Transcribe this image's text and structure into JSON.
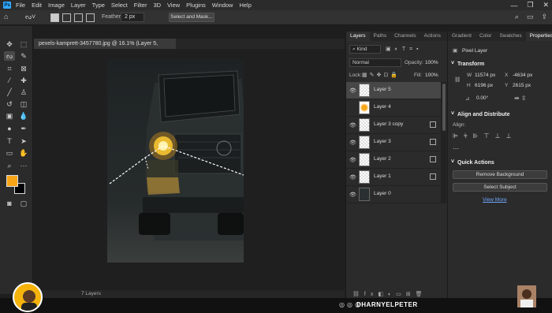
{
  "menu": {
    "items": [
      "File",
      "Edit",
      "Image",
      "Layer",
      "Type",
      "Select",
      "Filter",
      "3D",
      "View",
      "Plugins",
      "Window",
      "Help"
    ]
  },
  "options": {
    "feather_label": "Feather:",
    "feather_value": "2 px",
    "select_mask": "Select and Mask..."
  },
  "document": {
    "tab_title": "pexels-kamprett-3457780.jpg @ 16.1% (Layer 5, RGB/8) *",
    "status": "7 Layers"
  },
  "layers_panel": {
    "tabs": [
      "Layers",
      "Paths",
      "Channels",
      "Actions"
    ],
    "kind": "Kind",
    "blend_mode": "Normal",
    "opacity_label": "Opacity:",
    "opacity_value": "100%",
    "lock_label": "Lock:",
    "fill_label": "Fill:",
    "fill_value": "100%",
    "layers": [
      {
        "name": "Layer 5",
        "visible": true,
        "selected": true
      },
      {
        "name": "Layer 4",
        "visible": false,
        "selected": false
      },
      {
        "name": "Layer 3 copy",
        "visible": true,
        "selected": false
      },
      {
        "name": "Layer 3",
        "visible": true,
        "selected": false
      },
      {
        "name": "Layer 2",
        "visible": true,
        "selected": false
      },
      {
        "name": "Layer 1",
        "visible": true,
        "selected": false
      },
      {
        "name": "Layer 0",
        "visible": true,
        "selected": false
      }
    ]
  },
  "properties_panel": {
    "tabs": [
      "Gradient",
      "Color",
      "Swatches",
      "Properties"
    ],
    "pixel_layer": "Pixel Layer",
    "transform_head": "Transform",
    "w_label": "W",
    "w_value": "11574 px",
    "x_label": "X",
    "x_value": "-4634 px",
    "h_label": "H",
    "h_value": "6196 px",
    "y_label": "Y",
    "y_value": "2615 px",
    "angle_value": "0.00°",
    "align_head": "Align and Distribute",
    "align_label": "Align:",
    "quick_head": "Quick Actions",
    "remove_bg": "Remove Background",
    "select_subject": "Select Subject",
    "view_more": "View More"
  },
  "brand": {
    "name": "DHARNYELPETER"
  },
  "colors": {
    "foreground": "#f6a517",
    "background": "#000000",
    "accent": "#31a8ff"
  }
}
